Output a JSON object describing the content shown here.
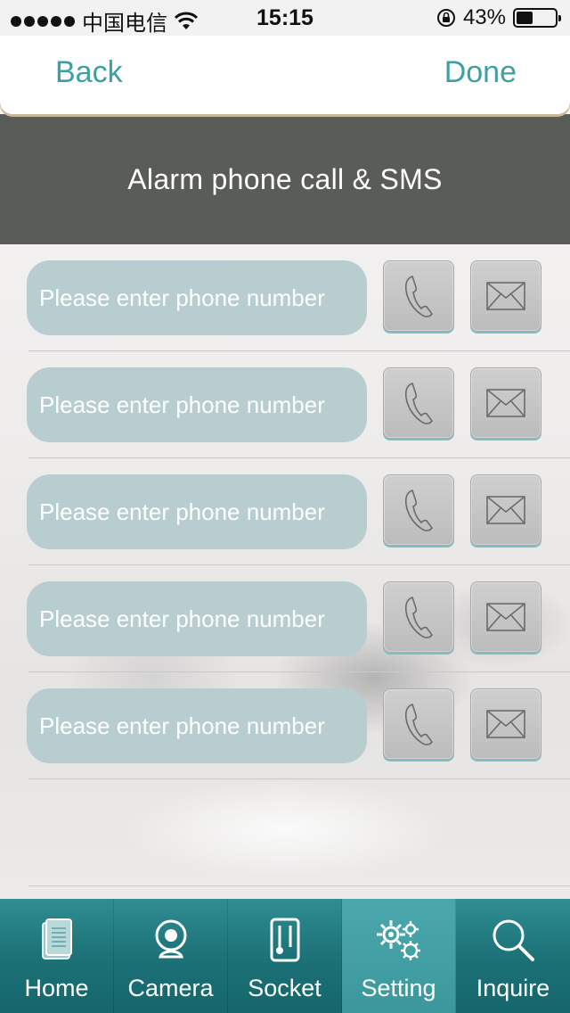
{
  "status_bar": {
    "carrier": "中国电信",
    "time": "15:15",
    "battery_percent": "43%",
    "battery_level": 0.43
  },
  "nav": {
    "back_label": "Back",
    "done_label": "Done"
  },
  "header": {
    "title": "Alarm phone call & SMS"
  },
  "rows": [
    {
      "placeholder": "Please enter phone number"
    },
    {
      "placeholder": "Please enter phone number"
    },
    {
      "placeholder": "Please enter phone number"
    },
    {
      "placeholder": "Please enter phone number"
    },
    {
      "placeholder": "Please enter phone number"
    }
  ],
  "tabs": [
    {
      "label": "Home",
      "icon": "home-icon"
    },
    {
      "label": "Camera",
      "icon": "camera-icon"
    },
    {
      "label": "Socket",
      "icon": "socket-icon"
    },
    {
      "label": "Setting",
      "icon": "gears-icon",
      "active": true
    },
    {
      "label": "Inquire",
      "icon": "magnifier-icon"
    }
  ],
  "colors": {
    "accent": "#3f9fa3",
    "header_bg": "#5a5c58",
    "input_bg": "#b7cdd0",
    "tab_bg": "#1c7277"
  }
}
